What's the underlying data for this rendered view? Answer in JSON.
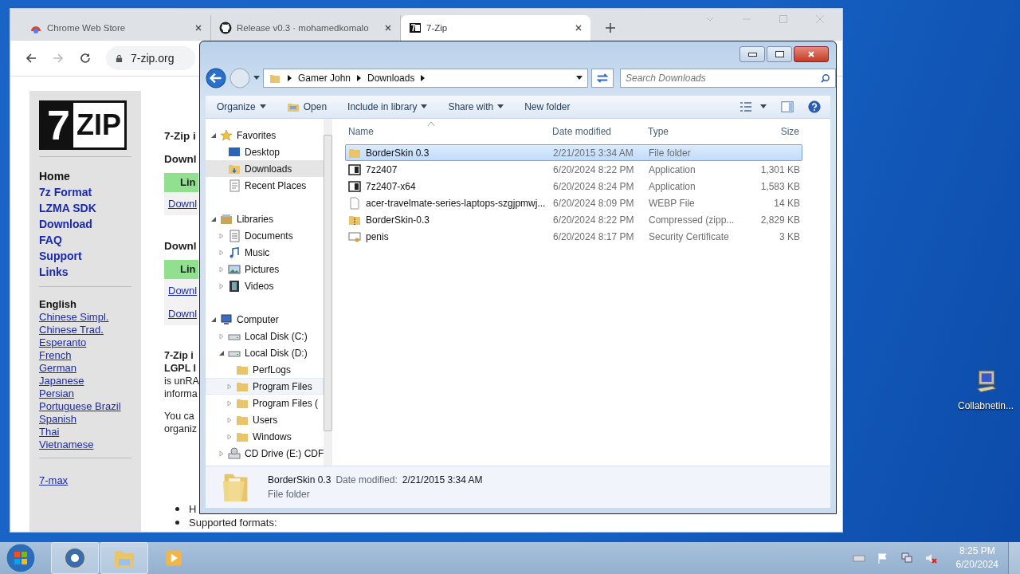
{
  "browser": {
    "tabs": [
      {
        "title": "Chrome Web Store",
        "kind": "store",
        "selected": false
      },
      {
        "title": "Release v0.3 · mohamedkomalo",
        "kind": "github",
        "selected": false
      },
      {
        "title": "7-Zip",
        "kind": "archive",
        "selected": true
      }
    ],
    "url": "7-zip.org",
    "page": {
      "logo": [
        "7",
        "ZIP"
      ],
      "nav": [
        {
          "label": "Home",
          "selected": true
        },
        {
          "label": "7z Format",
          "selected": false
        },
        {
          "label": "LZMA SDK",
          "selected": false
        },
        {
          "label": "Download",
          "selected": false
        },
        {
          "label": "FAQ",
          "selected": false
        },
        {
          "label": "Support",
          "selected": false
        },
        {
          "label": "Links",
          "selected": false
        }
      ],
      "languages": [
        {
          "label": "English",
          "selected": true
        },
        {
          "label": "Chinese Simpl.",
          "selected": false
        },
        {
          "label": "Chinese Trad.",
          "selected": false
        },
        {
          "label": "Esperanto",
          "selected": false
        },
        {
          "label": "French",
          "selected": false
        },
        {
          "label": "German",
          "selected": false
        },
        {
          "label": "Japanese",
          "selected": false
        },
        {
          "label": "Persian",
          "selected": false
        },
        {
          "label": "Portuguese Brazil",
          "selected": false
        },
        {
          "label": "Spanish",
          "selected": false
        },
        {
          "label": "Thai",
          "selected": false
        },
        {
          "label": "Vietnamese",
          "selected": false
        }
      ],
      "extra_link": "7-max",
      "blocks": [
        {
          "kind": "heading",
          "text": "7-Zip i"
        },
        {
          "kind": "section",
          "heading": "Downl",
          "bar": "Lin",
          "links": [
            "Downl"
          ]
        },
        {
          "kind": "section",
          "heading": "Downl",
          "bar": "Lin",
          "links": [
            "Downl",
            "Downl"
          ]
        },
        {
          "kind": "paragraph",
          "lines": [
            {
              "text": "7-Zip i",
              "bold": true
            },
            {
              "text": "LGPL l",
              "bold": true
            },
            {
              "text": "is unRA",
              "bold": false
            },
            {
              "text": "informa",
              "bold": false
            }
          ]
        },
        {
          "kind": "paragraph",
          "lines": [
            {
              "text": "You ca",
              "bold": false
            },
            {
              "text": "organiz",
              "bold": false
            }
          ]
        },
        {
          "kind": "bullets",
          "items": [
            "H",
            "Supported formats:"
          ]
        }
      ]
    }
  },
  "explorer": {
    "breadcrumb": [
      "Gamer John",
      "Downloads"
    ],
    "search": {
      "placeholder": "Search Downloads"
    },
    "toolbar": [
      {
        "label": "Organize",
        "kind": "text",
        "dropdown": true
      },
      {
        "label": "Open",
        "kind": "icon",
        "dropdown": false
      },
      {
        "label": "Include in library",
        "kind": "text",
        "dropdown": true
      },
      {
        "label": "Share with",
        "kind": "text",
        "dropdown": true
      },
      {
        "label": "New folder",
        "kind": "text",
        "dropdown": false
      }
    ],
    "nav": [
      {
        "label": "Favorites",
        "kind": "star",
        "expanded": true,
        "selected": false,
        "hovered": false,
        "children": [
          {
            "label": "Desktop",
            "kind": "desktop",
            "selected": false,
            "hovered": false
          },
          {
            "label": "Downloads",
            "kind": "downloads",
            "selected": true,
            "hovered": false
          },
          {
            "label": "Recent Places",
            "kind": "recent",
            "selected": false,
            "hovered": false
          }
        ]
      },
      {
        "label": "Libraries",
        "kind": "library",
        "expanded": true,
        "selected": false,
        "hovered": false,
        "children": [
          {
            "label": "Documents",
            "kind": "documents",
            "expanded": false,
            "selected": false,
            "hovered": false
          },
          {
            "label": "Music",
            "kind": "music",
            "expanded": false,
            "selected": false,
            "hovered": false
          },
          {
            "label": "Pictures",
            "kind": "pictures",
            "expanded": false,
            "selected": false,
            "hovered": false
          },
          {
            "label": "Videos",
            "kind": "videos",
            "expanded": false,
            "selected": false,
            "hovered": false
          }
        ]
      },
      {
        "label": "Computer",
        "kind": "computer",
        "expanded": true,
        "selected": false,
        "hovered": false,
        "children": [
          {
            "label": "Local Disk (C:)",
            "kind": "drive",
            "expanded": false,
            "selected": false,
            "hovered": false
          },
          {
            "label": "Local Disk (D:)",
            "kind": "drive",
            "expanded": true,
            "selected": false,
            "hovered": false,
            "children": [
              {
                "label": "PerfLogs",
                "kind": "folder",
                "selected": false,
                "hovered": false
              },
              {
                "label": "Program Files",
                "kind": "folder",
                "expanded": false,
                "selected": false,
                "hovered": true
              },
              {
                "label": "Program Files (",
                "kind": "folder",
                "expanded": false,
                "selected": false,
                "hovered": false
              },
              {
                "label": "Users",
                "kind": "folder",
                "expanded": false,
                "selected": false,
                "hovered": false
              },
              {
                "label": "Windows",
                "kind": "folder",
                "expanded": false,
                "selected": false,
                "hovered": false
              }
            ]
          },
          {
            "label": "CD Drive (E:) CDF",
            "kind": "cd",
            "expanded": false,
            "selected": false,
            "hovered": false
          }
        ]
      }
    ],
    "columns": [
      {
        "label": "Name",
        "sorted": true
      },
      {
        "label": "Date modified",
        "sorted": false
      },
      {
        "label": "Type",
        "sorted": false
      },
      {
        "label": "Size",
        "sorted": false
      }
    ],
    "files": [
      {
        "name": "BorderSkin 0.3",
        "date": "2/21/2015 3:34 AM",
        "type": "File folder",
        "kind": "folder",
        "selected": true
      },
      {
        "name": "7z2407",
        "date": "6/20/2024 8:22 PM",
        "type": "Application",
        "size": "1,301 KB",
        "kind": "app",
        "selected": false
      },
      {
        "name": "7z2407-x64",
        "date": "6/20/2024 8:24 PM",
        "type": "Application",
        "size": "1,583 KB",
        "kind": "app",
        "selected": false
      },
      {
        "name": "acer-travelmate-series-laptops-szgjpmwj...",
        "date": "6/20/2024 8:09 PM",
        "type": "WEBP File",
        "size": "14 KB",
        "kind": "file",
        "selected": false
      },
      {
        "name": "BorderSkin-0.3",
        "date": "6/20/2024 8:22 PM",
        "type": "Compressed (zipp...",
        "size": "2,829 KB",
        "kind": "zip",
        "selected": false
      },
      {
        "name": "penis",
        "date": "6/20/2024 8:17 PM",
        "type": "Security Certificate",
        "size": "3 KB",
        "kind": "cert",
        "selected": false
      }
    ],
    "details": {
      "name": "BorderSkin 0.3",
      "date_label": "Date modified:",
      "date": "2/21/2015 3:34 AM",
      "type": "File folder"
    }
  },
  "desktop_icons": [
    {
      "label": "Collabnetin..."
    }
  ],
  "taskbar": {
    "apps": [
      {
        "kind": "chrome",
        "running": true
      },
      {
        "kind": "explorer",
        "running": true
      },
      {
        "kind": "media",
        "running": false
      }
    ],
    "tray": {
      "muted": true
    },
    "time": "8:25 PM",
    "date": "6/20/2024"
  }
}
